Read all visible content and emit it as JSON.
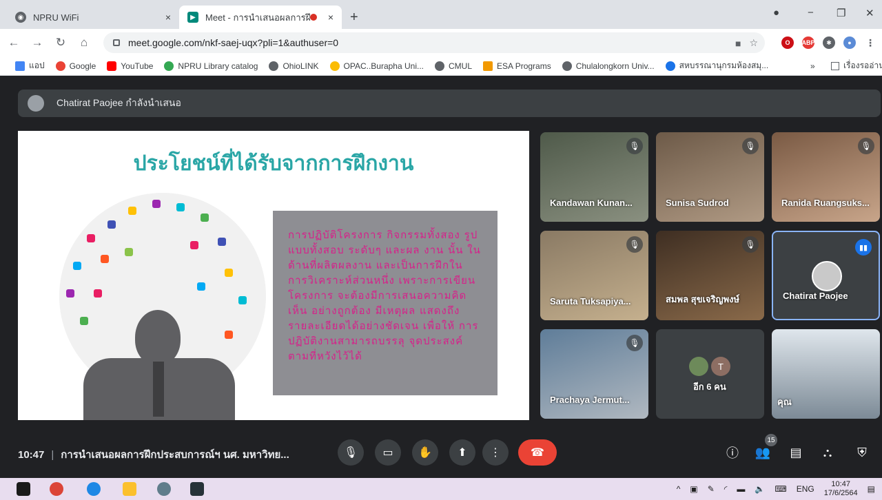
{
  "tabs": [
    {
      "title": "NPRU WiFi",
      "close": "×"
    },
    {
      "title": "Meet - การนำเสนอผลการฝึกประ",
      "close": "×"
    }
  ],
  "new_tab": "+",
  "window_controls": {
    "minimize": "−",
    "restore": "❐",
    "close": "✕"
  },
  "url": "meet.google.com/nkf-saej-uqx?pli=1&authuser=0",
  "bookmarks": [
    {
      "label": "แอป",
      "color": "#4285f4"
    },
    {
      "label": "Google",
      "color": "#ea4335"
    },
    {
      "label": "YouTube",
      "color": "#ff0000"
    },
    {
      "label": "NPRU Library catalog",
      "color": "#34a853"
    },
    {
      "label": "OhioLINK",
      "color": "#5f6368"
    },
    {
      "label": "OPAC..Burapha Uni...",
      "color": "#fbbc04"
    },
    {
      "label": "CMUL",
      "color": "#5f6368"
    },
    {
      "label": "ESA Programs",
      "color": "#f29900"
    },
    {
      "label": "Chulalongkorn Univ...",
      "color": "#5f6368"
    },
    {
      "label": "สหบรรณานุกรมห้องสมุ...",
      "color": "#1a73e8"
    }
  ],
  "bookmarks_more": "»",
  "bookmarks_reading": "เรื่องรออ่าน",
  "presenter_text": "Chatirat Paojee กำลังนำเสนอ",
  "slide": {
    "title": "ประโยชน์ที่ได้รับจากการฝึกงาน",
    "body": "การปฏิบัติโครงการ กิจกรรมทั้งสอง รูปแบบทั้งสอบ ระดับๆ และผล งาน นั้น ในด้านที่ผลิตผลงาน และเป็นการฝึกในการวิเคราะห์ส่วนหนึ่ง เพราะการเขียนโครงการ จะต้องมีการเสนอความคิดเห็น อย่างถูกต้อง มีเหตุผล แสดงถึง รายละเอียดได้อย่างชัดเจน เพื่อให้ การปฏิบัติงานสามารถบรรลุ จุดประสงค์ตามที่หวังไว้ได้"
  },
  "participants": [
    {
      "name": "Kandawan Kunan...",
      "bg": "#6b7a6a"
    },
    {
      "name": "Sunisa Sudrod",
      "bg": "#8a7a6a"
    },
    {
      "name": "Ranida Ruangsuks...",
      "bg": "#9a8270"
    },
    {
      "name": "Saruta Tuksapiya...",
      "bg": "#7d7060"
    },
    {
      "name": "สมพล สุขเจริญพงษ์",
      "bg": "#5b4a3a"
    },
    {
      "name": "Chatirat Paojee",
      "bg": "#3c4043"
    },
    {
      "name": "Prachaya Jermut...",
      "bg": "#6a7f92"
    },
    {
      "name": "อีก 6 คน",
      "bg": "#3c4043"
    },
    {
      "name": "คุณ",
      "bg": "#8e9aa6"
    }
  ],
  "more_initial": "T",
  "meeting": {
    "time": "10:47",
    "separator": "|",
    "name": "การนำเสนอผลการฝึกประสบการณ์ฯ นศ. มหาวิทย..."
  },
  "participant_count": "15",
  "tray": {
    "lang": "ENG",
    "time": "10:47",
    "date": "17/6/2564"
  }
}
